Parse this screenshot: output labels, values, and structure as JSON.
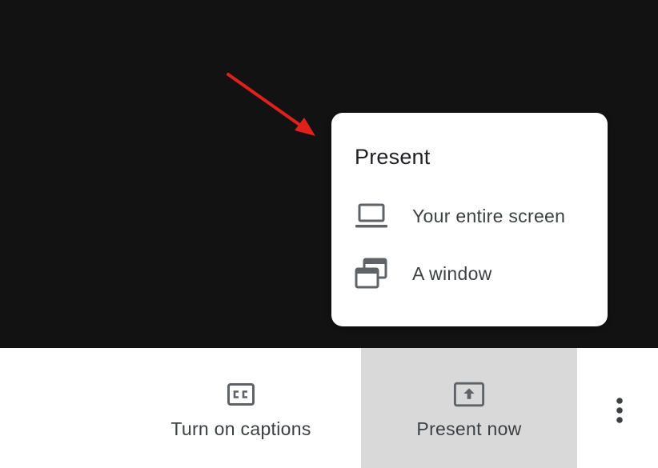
{
  "menu": {
    "title": "Present",
    "items": [
      {
        "label": "Your entire screen",
        "icon": "laptop-icon"
      },
      {
        "label": "A window",
        "icon": "window-icon"
      }
    ]
  },
  "toolbar": {
    "captions": {
      "label": "Turn on captions",
      "icon": "closed-captions-icon"
    },
    "present_now": {
      "label": "Present now",
      "icon": "present-to-all-icon"
    },
    "more": {
      "icon": "more-vert-icon"
    }
  },
  "colors": {
    "video_background": "#121212",
    "menu_background": "#ffffff",
    "present_now_active": "#d9d9d9",
    "icon_gray": "#5f6368",
    "annotation_arrow": "#e0201b"
  }
}
